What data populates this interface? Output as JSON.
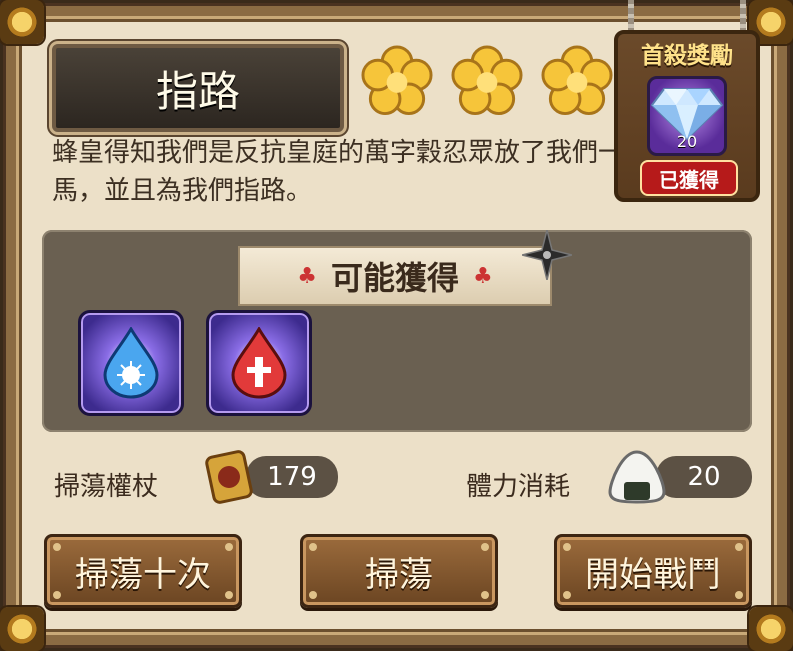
{
  "stage": {
    "title": "指路",
    "stars": 3,
    "description": "蜂皇得知我們是反抗皇庭的萬字穀忍眾放了我們一馬，並且為我們指路。"
  },
  "first_clear_reward": {
    "title": "首殺獎勵",
    "item_icon": "diamond-icon",
    "count": "20",
    "status": "已獲得"
  },
  "drops": {
    "title": "可能獲得",
    "items": [
      {
        "icon": "blue-water-drop-icon"
      },
      {
        "icon": "red-blood-drop-icon"
      }
    ]
  },
  "resources": {
    "sweep_scepter_label": "掃蕩權杖",
    "sweep_scepter_count": "179",
    "stamina_cost_label": "體力消耗",
    "stamina_cost_value": "20"
  },
  "buttons": {
    "sweep_ten": "掃蕩十次",
    "sweep": "掃蕩",
    "start_battle": "開始戰鬥"
  },
  "colors": {
    "panel_bg": "#ece0c8",
    "frame": "#8b6b43",
    "accent_gold": "#f6c53a",
    "obtained_red": "#b61a1a"
  }
}
